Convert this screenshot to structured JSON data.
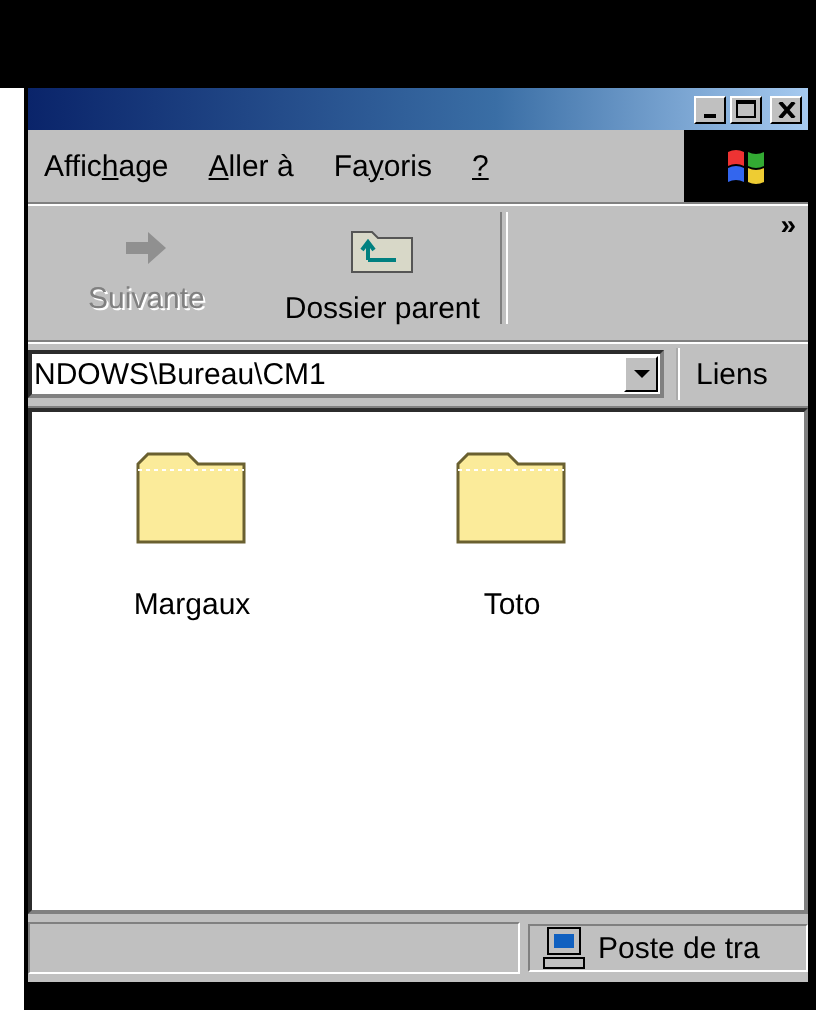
{
  "menu": [
    {
      "before": "Affic",
      "key": "h",
      "after": "age"
    },
    {
      "key": "A",
      "after": "ller à"
    },
    {
      "before": "Fa",
      "key": "y",
      "after": "oris"
    },
    {
      "key": "?"
    }
  ],
  "toolbar": {
    "buttons": [
      {
        "label": "Suivante",
        "disabled": true,
        "kind": "forward"
      },
      {
        "label": "Dossier parent",
        "disabled": false,
        "kind": "up"
      }
    ],
    "overflow": "»"
  },
  "address": {
    "value": "NDOWS\\Bureau\\CM1",
    "links": "Liens"
  },
  "folders": [
    {
      "name": "Margaux"
    },
    {
      "name": "Toto"
    }
  ],
  "status_bar": {
    "zone": "Poste de tra"
  }
}
